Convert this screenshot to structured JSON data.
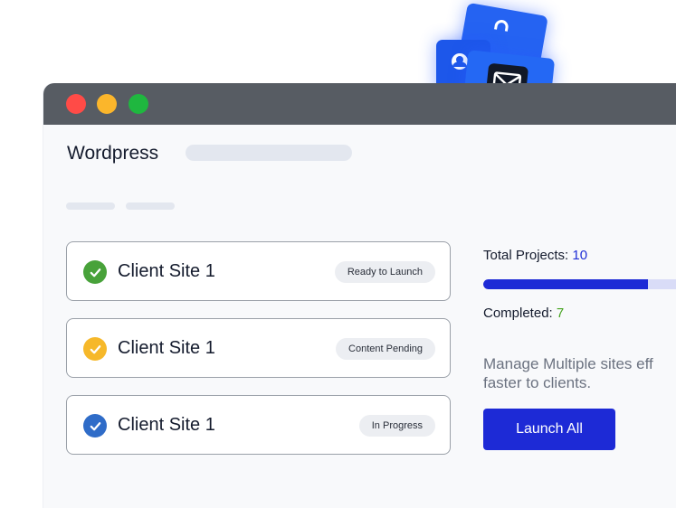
{
  "app": {
    "title": "Wordpress"
  },
  "window_controls": [
    "close",
    "minimize",
    "maximize"
  ],
  "sites": [
    {
      "name": "Client Site 1",
      "status": "Ready to Launch",
      "icon": "check-icon",
      "color": "#48a23a"
    },
    {
      "name": "Client Site 1",
      "status": "Content Pending",
      "icon": "check-icon",
      "color": "#f6b82a"
    },
    {
      "name": "Client Site 1",
      "status": "In Progress",
      "icon": "check-icon",
      "color": "#2f6cc8"
    }
  ],
  "stats": {
    "total_label": "Total Projects:",
    "total_value": "10",
    "completed_label": "Completed:",
    "completed_value": "7",
    "progress_fraction": 0.7
  },
  "description": "Manage Multiple sites eff\nfaster to clients.",
  "launch_button": "Launch All",
  "floating_icons": [
    "lock-icon",
    "user-icon",
    "mail-icon"
  ],
  "colors": {
    "accent": "#1d2ad6",
    "titlebar": "#575c63",
    "completed": "#45a31f"
  }
}
